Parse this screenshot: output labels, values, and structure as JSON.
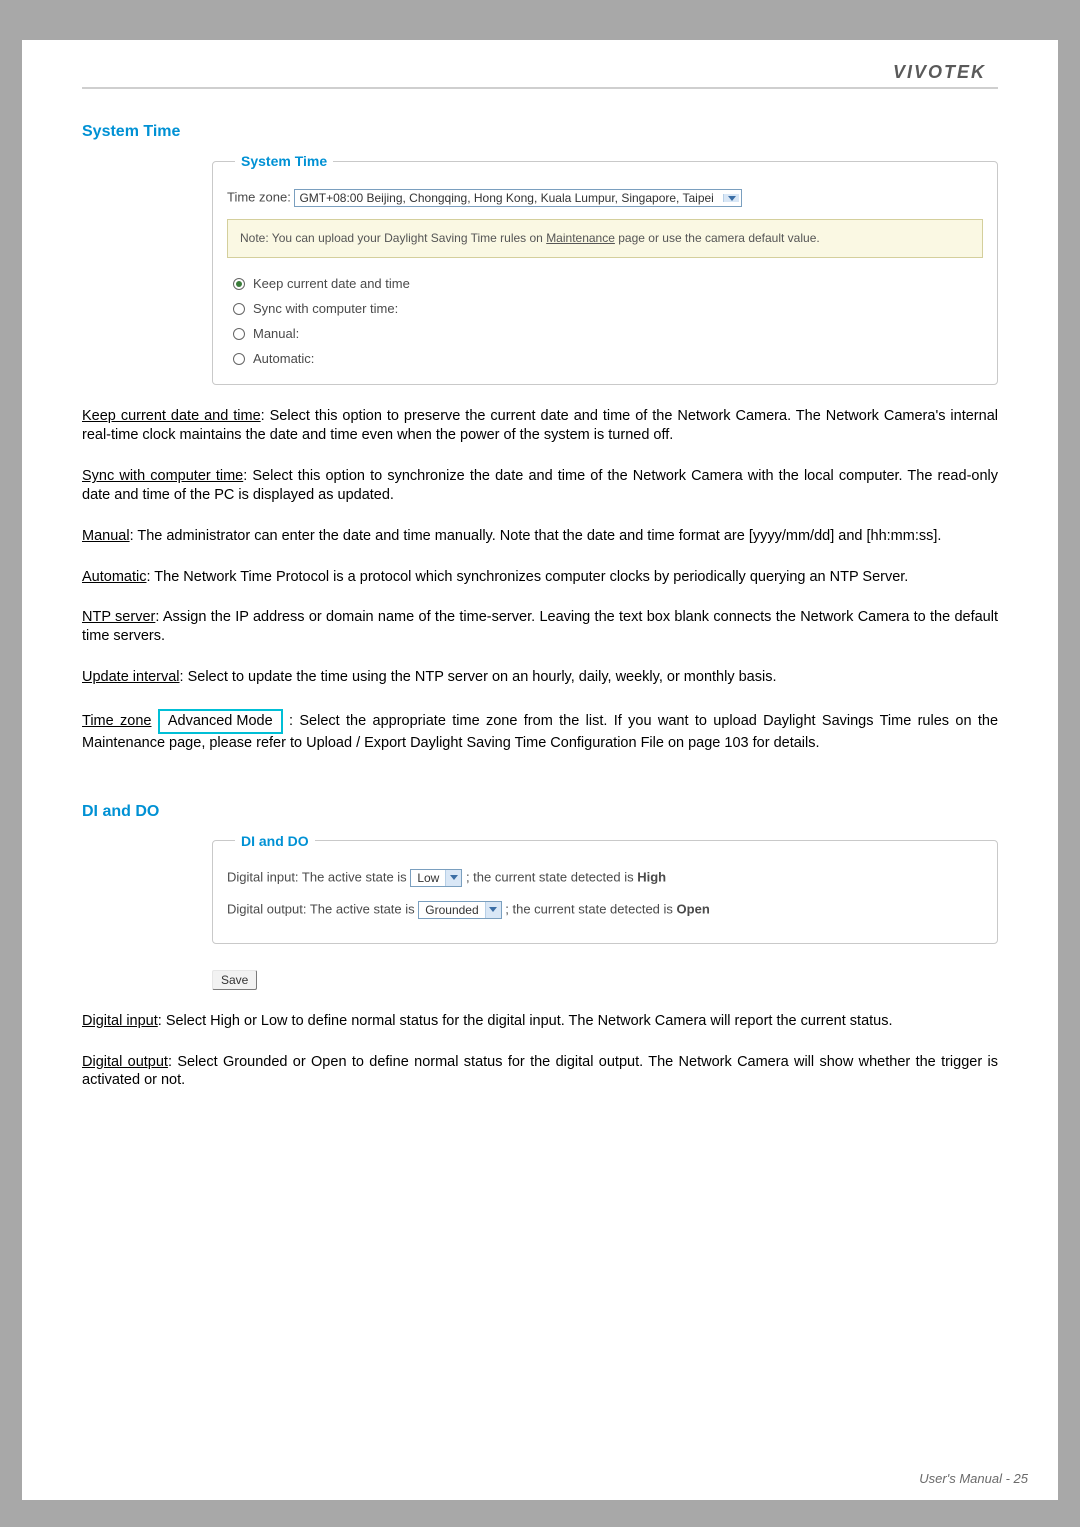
{
  "header": {
    "brand": "VIVOTEK"
  },
  "section1": {
    "heading": "System Time",
    "panel_title": "System Time",
    "timezone_label": "Time zone:",
    "timezone_value": "GMT+08:00 Beijing, Chongqing, Hong Kong, Kuala Lumpur, Singapore, Taipei",
    "note_prefix": "Note: You can upload your Daylight Saving Time rules on ",
    "note_link": "Maintenance",
    "note_suffix": " page or use the camera default value.",
    "radios": {
      "keep": "Keep current date and time",
      "sync": "Sync with computer time:",
      "manual": "Manual:",
      "auto": "Automatic:"
    }
  },
  "desc": {
    "keep_t": "Keep current date and time",
    "keep_b": ": Select this option to preserve the current date and time of the Network Camera. The Network Camera's internal real-time clock maintains the date and time even when the power of the system is turned off.",
    "sync_t": "Sync with computer time",
    "sync_b": ": Select this option to synchronize the date and time of the Network Camera with the local computer. The read-only date and time of the PC is displayed as updated.",
    "manual_t": "Manual",
    "manual_b": ": The administrator can enter the date and time manually. Note that the date and time format are [yyyy/mm/dd] and [hh:mm:ss].",
    "auto_t": "Automatic",
    "auto_b": ": The Network Time Protocol is a protocol which synchronizes computer clocks by periodically querying an NTP Server.",
    "ntp_t": "NTP server",
    "ntp_b": ": Assign the IP address or domain name of the time-server. Leaving the text box blank connects the Network Camera to the default time servers.",
    "upd_t": "Update interval",
    "upd_b": ": Select to update the time using the NTP server on an hourly, daily, weekly, or monthly basis.",
    "tz_t": "Time zone",
    "tz_box": "Advanced Mode",
    "tz_b": ": Select the appropriate time zone from the list. If you want to upload Daylight Savings Time rules on the Maintenance page, please refer to Upload / Export Daylight Saving Time Configuration File on page 103 for details."
  },
  "section2": {
    "heading": "DI and DO",
    "panel_title": "DI and DO",
    "di_prefix": "Digital input: The active state is",
    "di_select": "Low",
    "di_suffix": "; the current state detected is",
    "di_state": "High",
    "do_prefix": "Digital output: The active state is",
    "do_select": "Grounded",
    "do_suffix": "; the current state detected is",
    "do_state": "Open",
    "save_label": "Save"
  },
  "desc2": {
    "di_t": "Digital input",
    "di_b": ": Select High or Low to define normal status for the digital input. The Network Camera will report the current status.",
    "do_t": "Digital output",
    "do_b": ": Select Grounded or Open to define normal status for the digital output. The Network Camera will show whether the trigger is activated or not."
  },
  "footer": {
    "label": "User's Manual - ",
    "page": "25"
  }
}
